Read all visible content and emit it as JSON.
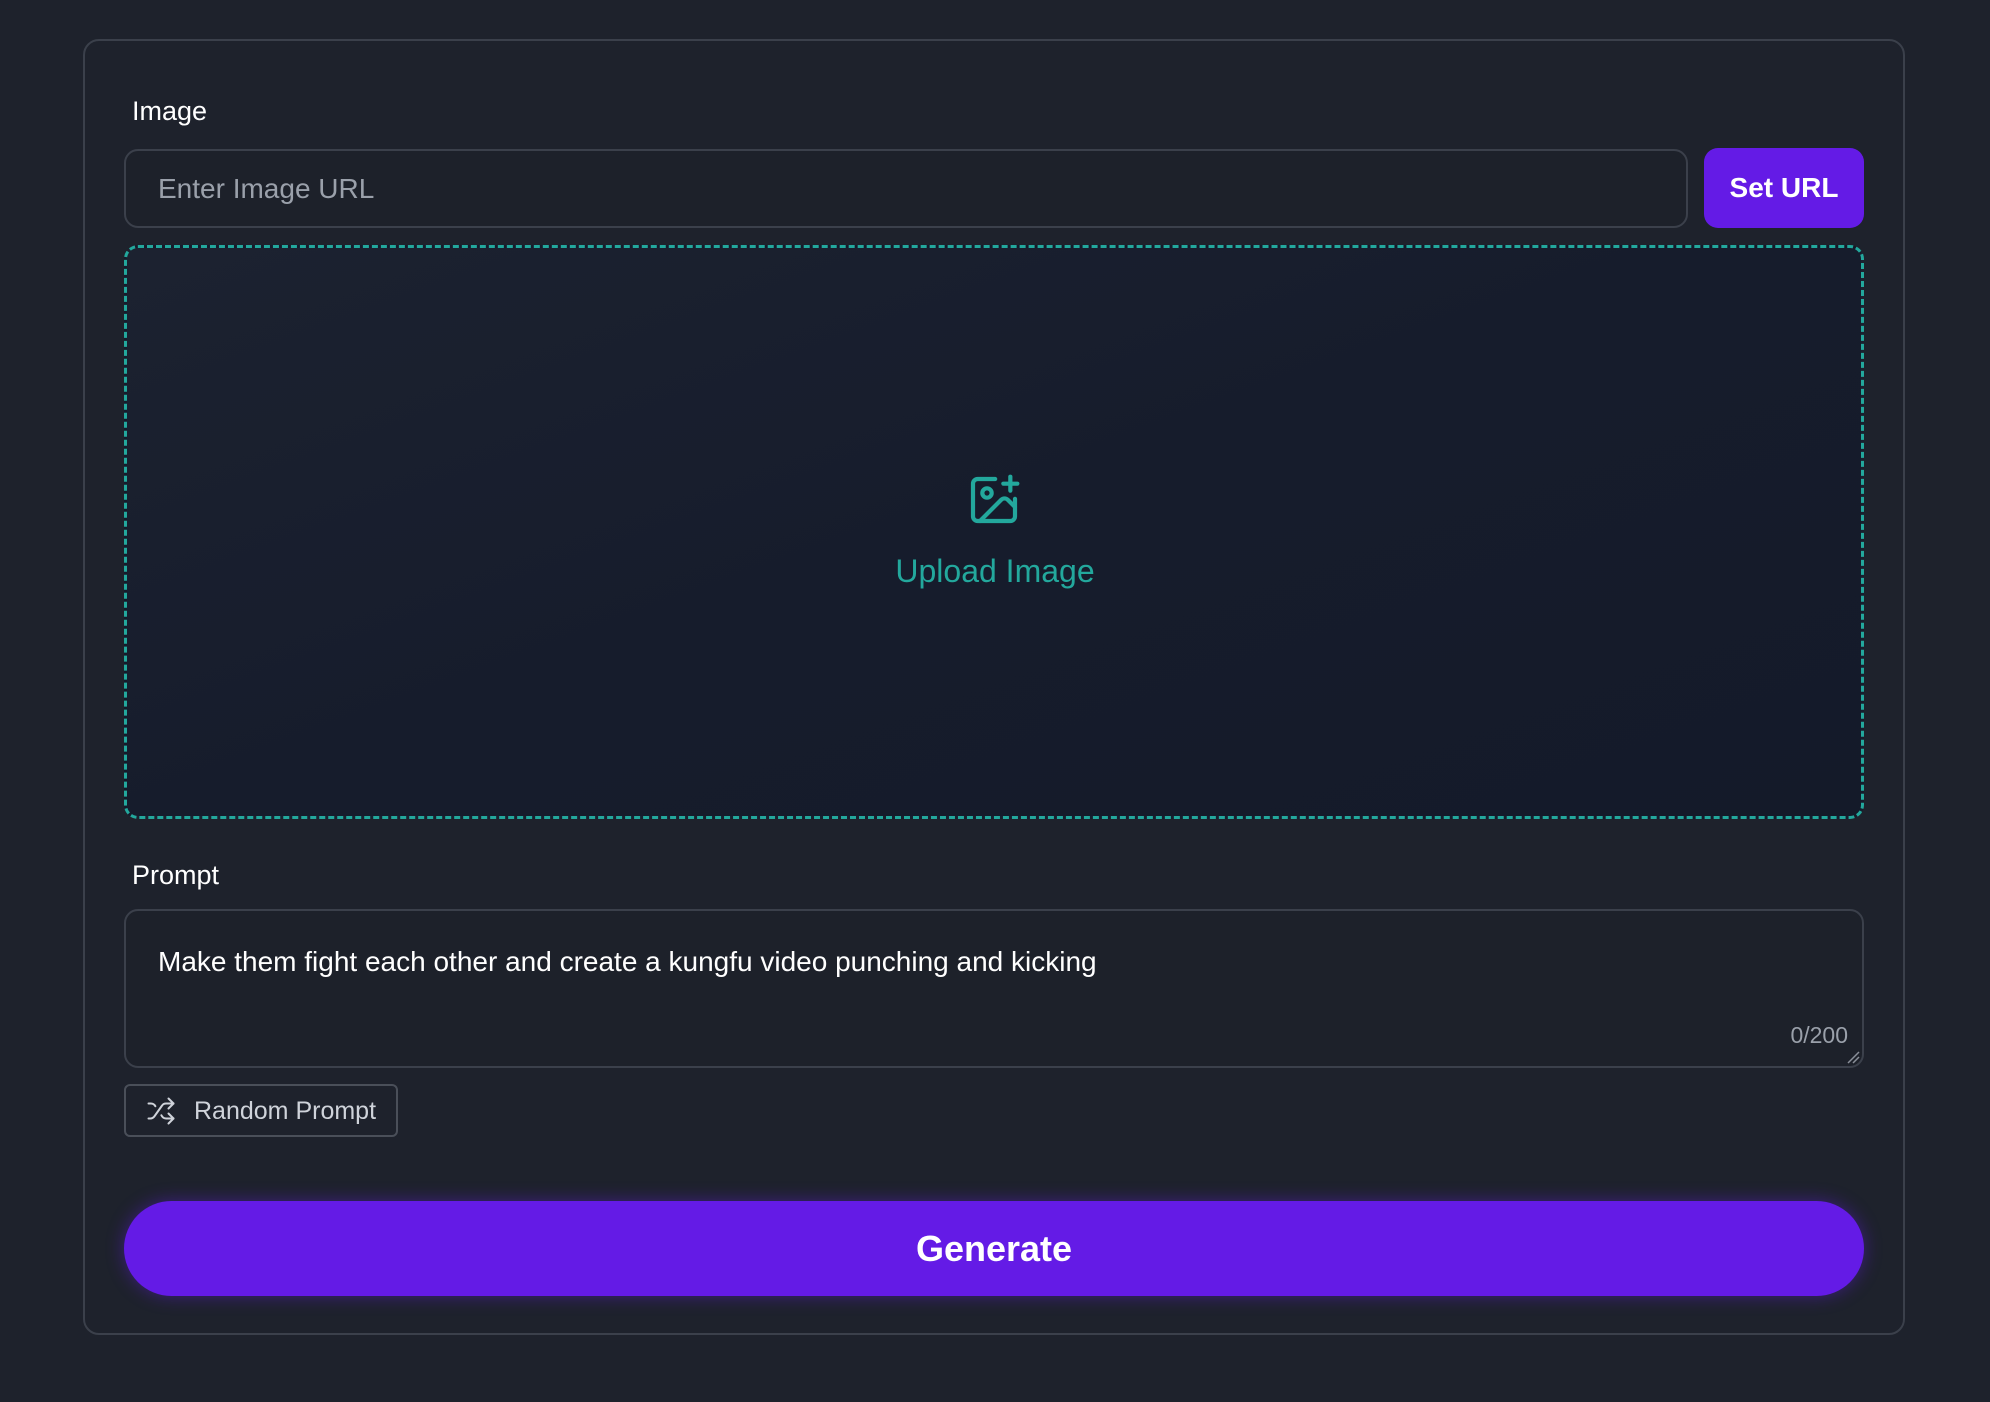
{
  "image_section": {
    "label": "Image",
    "url_placeholder": "Enter Image URL",
    "url_value": "",
    "set_url_label": "Set URL"
  },
  "dropzone": {
    "icon": "image-plus-icon",
    "label": "Upload Image"
  },
  "prompt_section": {
    "label": "Prompt",
    "value": "Make them fight each other and create a kungfu video punching and kicking",
    "counter": "0/200"
  },
  "random_prompt": {
    "icon": "shuffle-icon",
    "label": "Random Prompt"
  },
  "generate": {
    "label": "Generate"
  },
  "colors": {
    "background": "#1e222c",
    "accent": "#641be6",
    "teal": "#23a89d",
    "border": "#3b404b"
  }
}
